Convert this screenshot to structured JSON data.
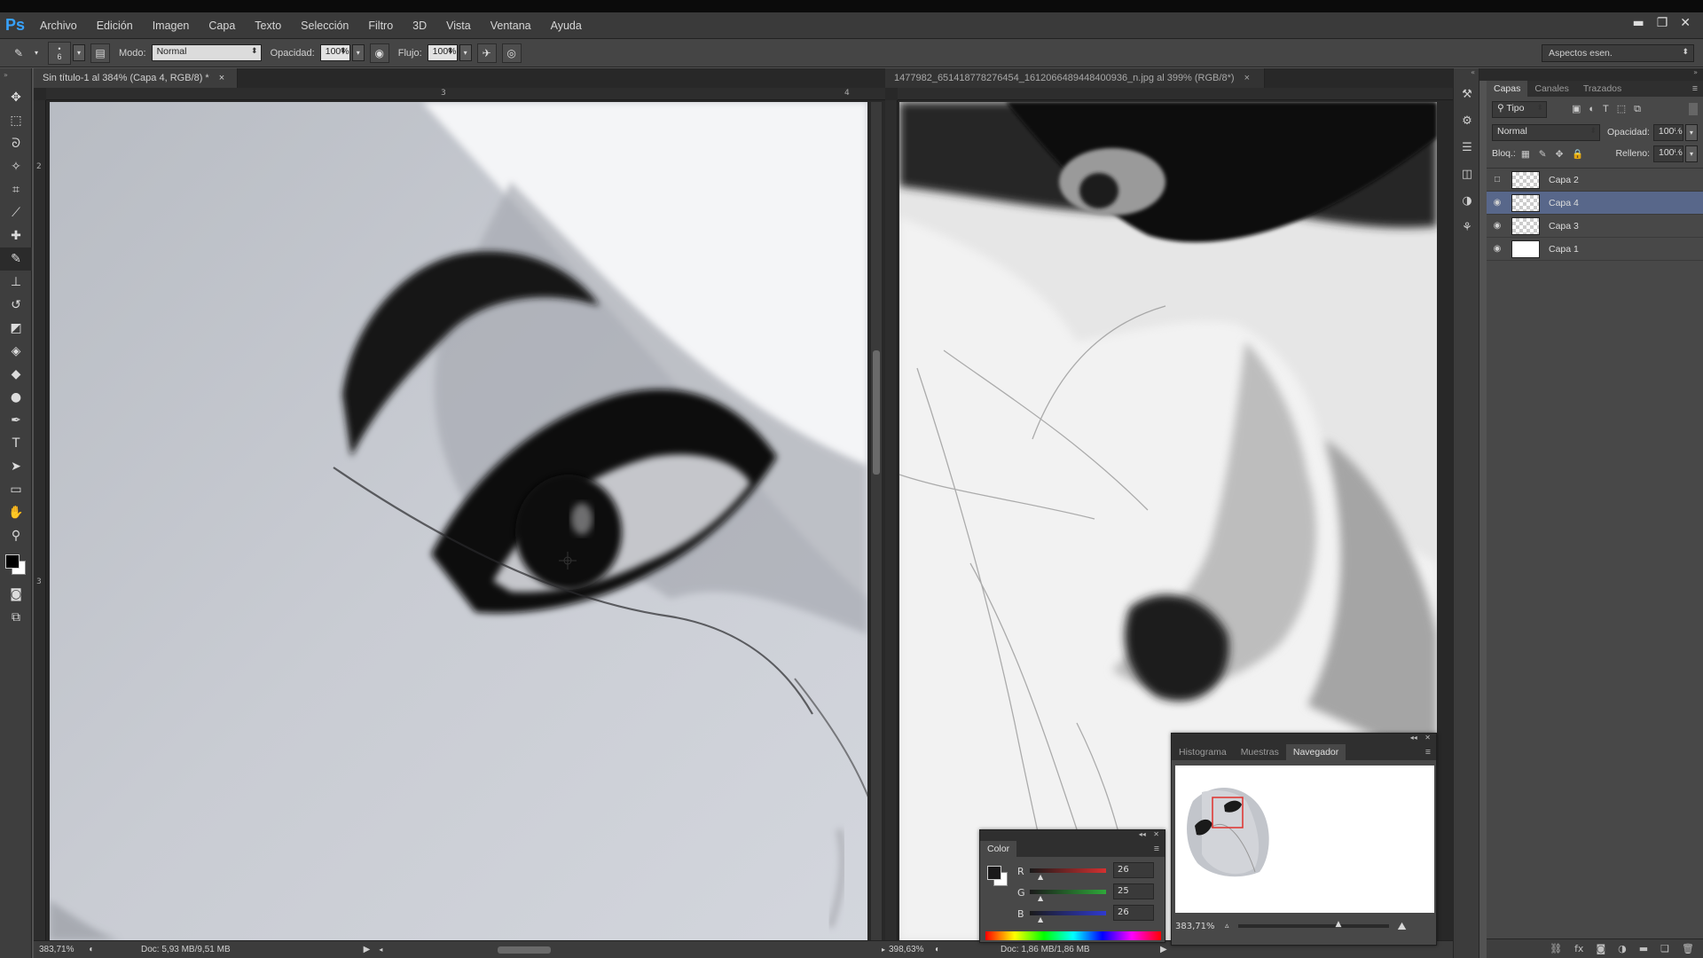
{
  "app": {
    "logo": "Ps"
  },
  "menu": [
    "Archivo",
    "Edición",
    "Imagen",
    "Capa",
    "Texto",
    "Selección",
    "Filtro",
    "3D",
    "Vista",
    "Ventana",
    "Ayuda"
  ],
  "options": {
    "brush_size": "6",
    "mode_label": "Modo:",
    "mode_value": "Normal",
    "opacity_label": "Opacidad:",
    "opacity_value": "100%",
    "flow_label": "Flujo:",
    "flow_value": "100%",
    "workspace": "Aspectos esen."
  },
  "doc1": {
    "tab": "Sin título-1 al 384% (Capa 4, RGB/8) *",
    "zoom": "383,71%",
    "doc_size": "Doc: 5,93 MB/9,51 MB",
    "ruler_marks": [
      "3",
      "4"
    ],
    "vruler_marks": [
      "2",
      "3"
    ]
  },
  "doc2": {
    "tab": "1477982_651418778276454_1612066489448400936_n.jpg al 399% (RGB/8*)",
    "zoom": "398,63%",
    "doc_size": "Doc: 1,86 MB/1,86 MB"
  },
  "layers_panel": {
    "tabs": [
      "Capas",
      "Canales",
      "Trazados"
    ],
    "filter": "Tipo",
    "blend_mode": "Normal",
    "opacity_label": "Opacidad:",
    "opacity": "100%",
    "lock_label": "Bloq.:",
    "fill_label": "Relleno:",
    "fill": "100%",
    "layers": [
      {
        "name": "Capa 2",
        "visible": false,
        "active": false,
        "white": false
      },
      {
        "name": "Capa 4",
        "visible": true,
        "active": true,
        "white": false
      },
      {
        "name": "Capa 3",
        "visible": true,
        "active": false,
        "white": false
      },
      {
        "name": "Capa 1",
        "visible": true,
        "active": false,
        "white": true
      }
    ]
  },
  "navigator_panel": {
    "tabs": [
      "Histograma",
      "Muestras",
      "Navegador"
    ],
    "zoom": "383,71%"
  },
  "color_panel": {
    "tab": "Color",
    "r_label": "R",
    "r": "26",
    "g_label": "G",
    "g": "25",
    "b_label": "B",
    "b": "26",
    "colors": {
      "r_slider": "#d43030",
      "g_slider": "#2fa83a",
      "b_slider": "#2f3ad0",
      "layer_active": "#58678a",
      "nav_box": "#e0302c"
    }
  }
}
